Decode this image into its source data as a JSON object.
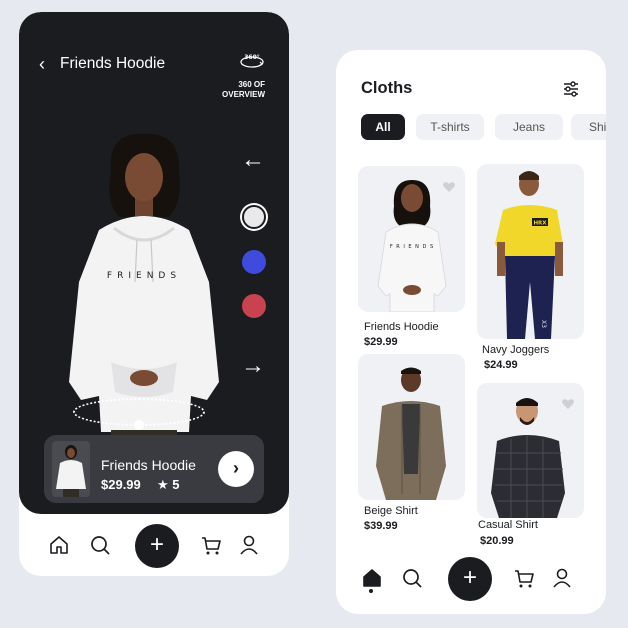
{
  "detail": {
    "title": "Friends Hoodie",
    "back_icon": "chevron-left-icon",
    "overview_label": "360 OF OVERVIEW",
    "overview_icon": "rotate-360-icon",
    "model_print": "FRIENDS",
    "swatches": [
      "#e9e9ec",
      "#3f4bdc",
      "#c9424f"
    ],
    "card": {
      "title": "Friends Hoodie",
      "price": "$29.99",
      "rating": "★ 5",
      "action_icon": "chevron-right-icon"
    }
  },
  "nav": {
    "items": [
      "home-icon",
      "search-icon",
      "plus-icon",
      "cart-icon",
      "user-icon"
    ],
    "plus_label": "+"
  },
  "catalog": {
    "title": "Cloths",
    "filter_icon": "sliders-icon",
    "chips": [
      "All",
      "T-shirts",
      "Jeans",
      "Shi"
    ],
    "active_chip": "All",
    "products": [
      {
        "name": "Friends Hoodie",
        "price": "$29.99",
        "chest_print": "F R I E N D S"
      },
      {
        "name": "Navy Joggers",
        "price": "$24.99",
        "chest_print": "HRX",
        "leg_print": "X3"
      },
      {
        "name": "Beige Shirt",
        "price": "$39.99"
      },
      {
        "name": "Casual Shirt",
        "price": "$20.99"
      }
    ]
  },
  "colors": {
    "dark": "#1b1c20",
    "accent_blue": "#3f4bdc",
    "accent_red": "#c9424f",
    "background": "#e7e9f0"
  }
}
